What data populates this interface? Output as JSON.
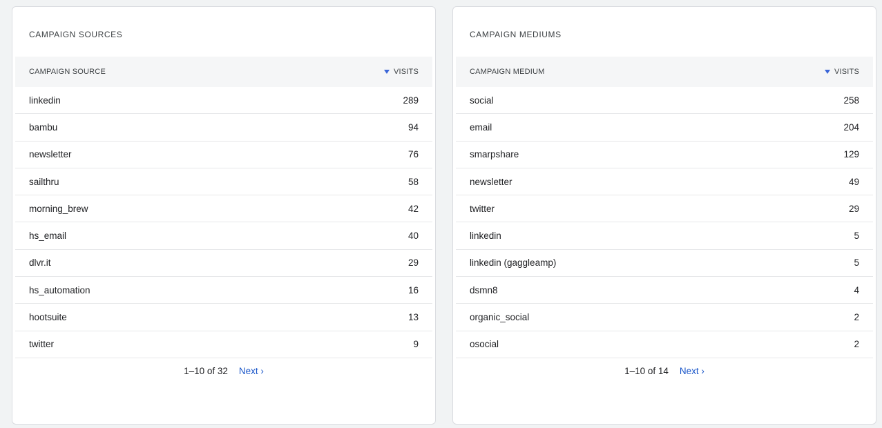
{
  "sources": {
    "title": "CAMPAIGN SOURCES",
    "col_label": "CAMPAIGN SOURCE",
    "col_value": "VISITS",
    "rows": [
      {
        "label": "linkedin",
        "value": "289"
      },
      {
        "label": "bambu",
        "value": "94"
      },
      {
        "label": "newsletter",
        "value": "76"
      },
      {
        "label": "sailthru",
        "value": "58"
      },
      {
        "label": "morning_brew",
        "value": "42"
      },
      {
        "label": "hs_email",
        "value": "40"
      },
      {
        "label": "dlvr.it",
        "value": "29"
      },
      {
        "label": "hs_automation",
        "value": "16"
      },
      {
        "label": "hootsuite",
        "value": "13"
      },
      {
        "label": "twitter",
        "value": "9"
      }
    ],
    "pager_range": "1–10 of 32",
    "pager_next": "Next ›"
  },
  "mediums": {
    "title": "CAMPAIGN MEDIUMS",
    "col_label": "CAMPAIGN MEDIUM",
    "col_value": "VISITS",
    "rows": [
      {
        "label": "social",
        "value": "258"
      },
      {
        "label": "email",
        "value": "204"
      },
      {
        "label": "smarpshare",
        "value": "129"
      },
      {
        "label": "newsletter",
        "value": "49"
      },
      {
        "label": "twitter",
        "value": "29"
      },
      {
        "label": "linkedin",
        "value": "5"
      },
      {
        "label": "linkedin (gaggleamp)",
        "value": "5"
      },
      {
        "label": "dsmn8",
        "value": "4"
      },
      {
        "label": "organic_social",
        "value": "2"
      },
      {
        "label": "osocial",
        "value": "2"
      }
    ],
    "pager_range": "1–10 of 14",
    "pager_next": "Next ›"
  },
  "icons": {
    "sort": "sort-descending-icon"
  },
  "colors": {
    "accent": "#1a56c9",
    "header_bg": "#f5f6f7",
    "border": "#dadce0"
  }
}
